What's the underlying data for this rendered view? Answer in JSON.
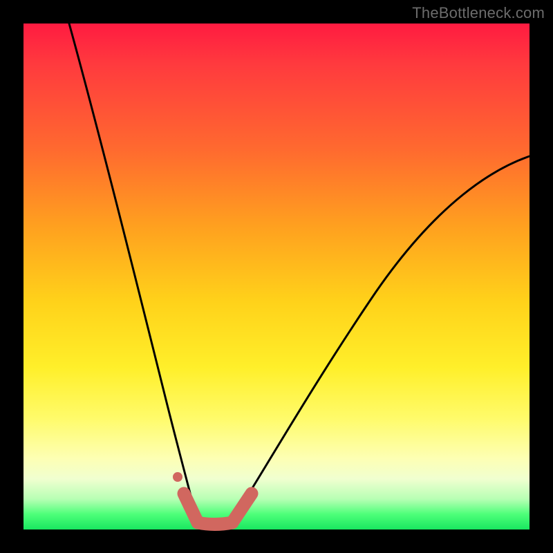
{
  "watermark": "TheBottleneck.com",
  "colors": {
    "frame": "#000000",
    "curve_stroke": "#000000",
    "marker_stroke": "#d1675f",
    "marker_fill": "#d1675f"
  },
  "chart_data": {
    "type": "line",
    "title": "",
    "xlabel": "",
    "ylabel": "",
    "xlim": [
      0,
      100
    ],
    "ylim": [
      0,
      100
    ],
    "series": [
      {
        "name": "left-branch",
        "x": [
          9,
          12,
          15,
          18,
          21,
          24,
          26,
          28,
          30,
          31.5,
          33
        ],
        "y": [
          100,
          84,
          69,
          55,
          42,
          30,
          22,
          15,
          8,
          4,
          1.5
        ]
      },
      {
        "name": "valley-floor",
        "x": [
          33,
          35,
          37,
          39,
          41
        ],
        "y": [
          1.5,
          0.8,
          0.7,
          0.8,
          1.5
        ]
      },
      {
        "name": "right-branch",
        "x": [
          41,
          45,
          50,
          55,
          60,
          65,
          70,
          75,
          80,
          85,
          90,
          95,
          100
        ],
        "y": [
          1.5,
          6,
          13,
          20,
          27,
          34,
          41,
          48,
          54,
          60,
          65,
          70,
          74
        ]
      }
    ],
    "markers": [
      {
        "name": "dot-left-upper",
        "x": 30.2,
        "y": 10,
        "r": 1.0
      },
      {
        "name": "thick-left",
        "kind": "segment",
        "x1": 31.5,
        "y1": 6.5,
        "x2": 33.7,
        "y2": 1.2,
        "w": 2.6
      },
      {
        "name": "thick-floor",
        "kind": "segment",
        "x1": 33.7,
        "y1": 1.2,
        "x2": 40.8,
        "y2": 1.2,
        "w": 2.6
      },
      {
        "name": "thick-right",
        "kind": "segment",
        "x1": 40.8,
        "y1": 1.2,
        "x2": 44.8,
        "y2": 6.8,
        "w": 2.6
      }
    ]
  }
}
